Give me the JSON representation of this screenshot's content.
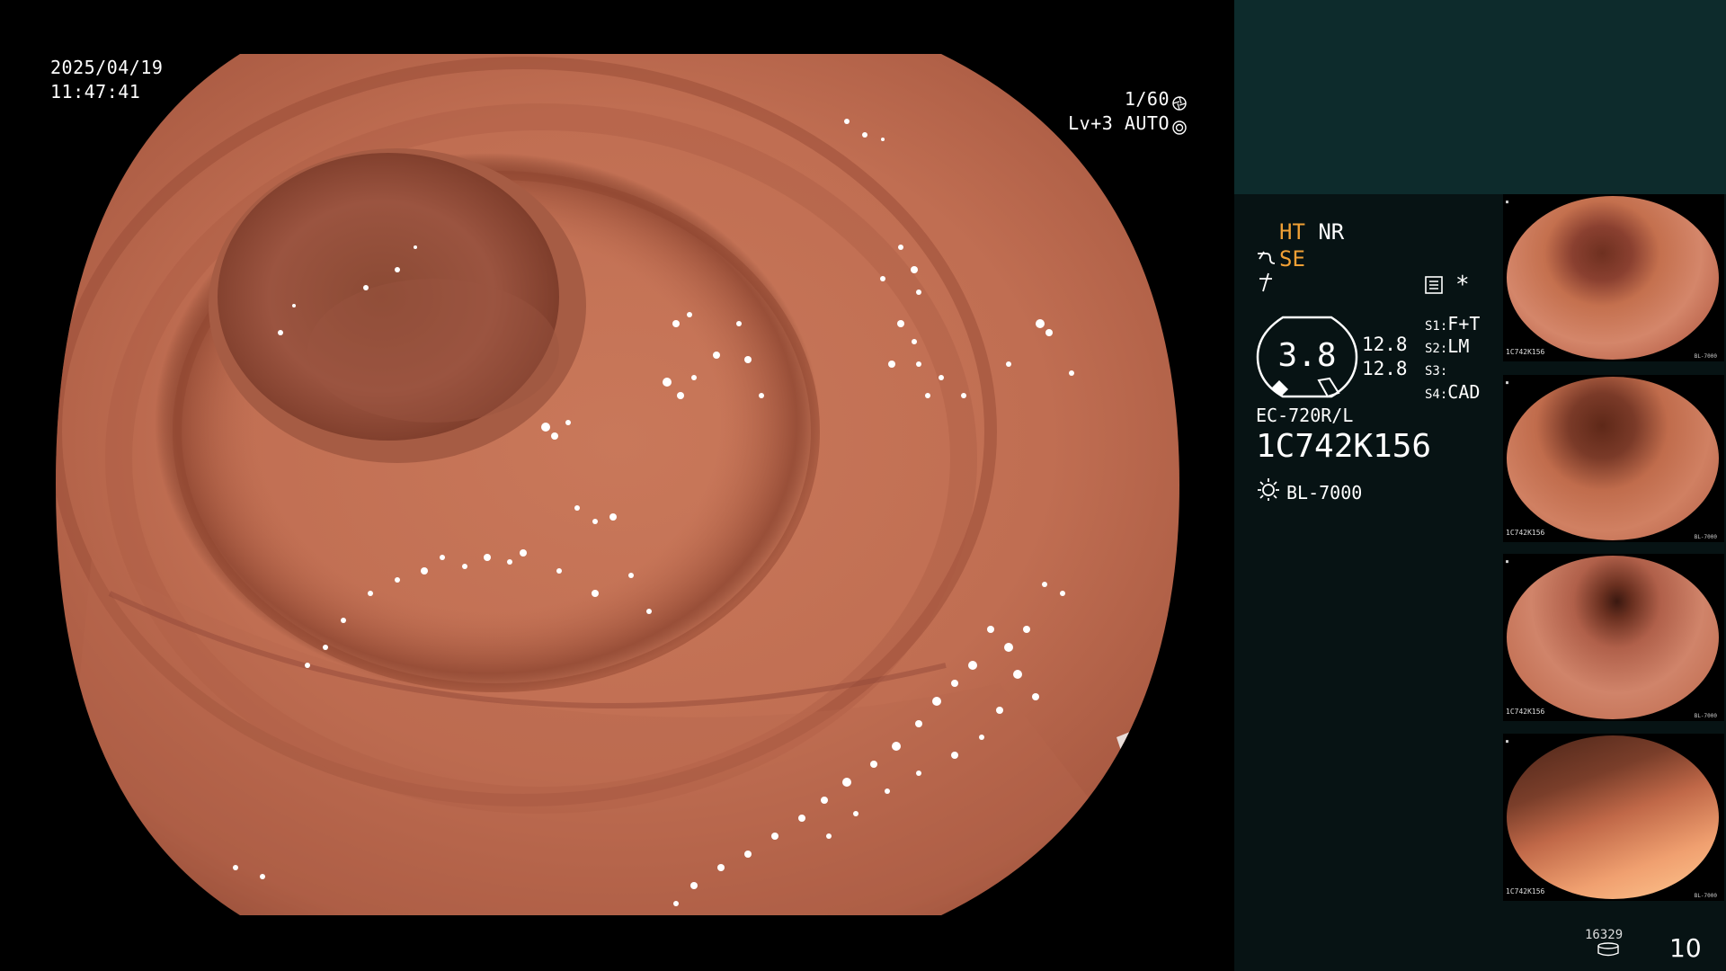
{
  "overlay": {
    "date": "2025/04/19",
    "time": "11:47:41",
    "shutter": "1/60",
    "exposure_mode": "Lv+3 AUTO"
  },
  "panel": {
    "ht": "HT",
    "nr": "NR",
    "se": "SE",
    "iris_value": "3.8",
    "iris_right_1": "12.8",
    "iris_right_2": "12.8",
    "switches": [
      {
        "key": "S1",
        "value": "F+T"
      },
      {
        "key": "S2",
        "value": "LM"
      },
      {
        "key": "S3",
        "value": ""
      },
      {
        "key": "S4",
        "value": "CAD"
      }
    ],
    "scope_model": "EC-720R/L",
    "scope_serial": "1C742K156",
    "light_source": "BL-7000",
    "asterisk": "*"
  },
  "thumbnails": [
    {
      "serial": "1C742K156",
      "caption": "BL-7000"
    },
    {
      "serial": "1C742K156",
      "caption": "BL-7000"
    },
    {
      "serial": "1C742K156",
      "caption": "BL-7000"
    },
    {
      "serial": "1C742K156",
      "caption": "BL-7000"
    }
  ],
  "footer": {
    "storage_count": "16329",
    "page_number": "10"
  },
  "colors": {
    "panel_bg": "#071314",
    "header_bg": "#0d2b2c",
    "accent_orange": "#f0a035",
    "mucosa": "#c8785a"
  },
  "icons": [
    "shutter-icon",
    "auto-iris-icon",
    "structure-enhance-icon",
    "color-enhance-icon",
    "record-doc-icon",
    "iris-gauge-icon",
    "lamp-icon",
    "storage-icon"
  ]
}
